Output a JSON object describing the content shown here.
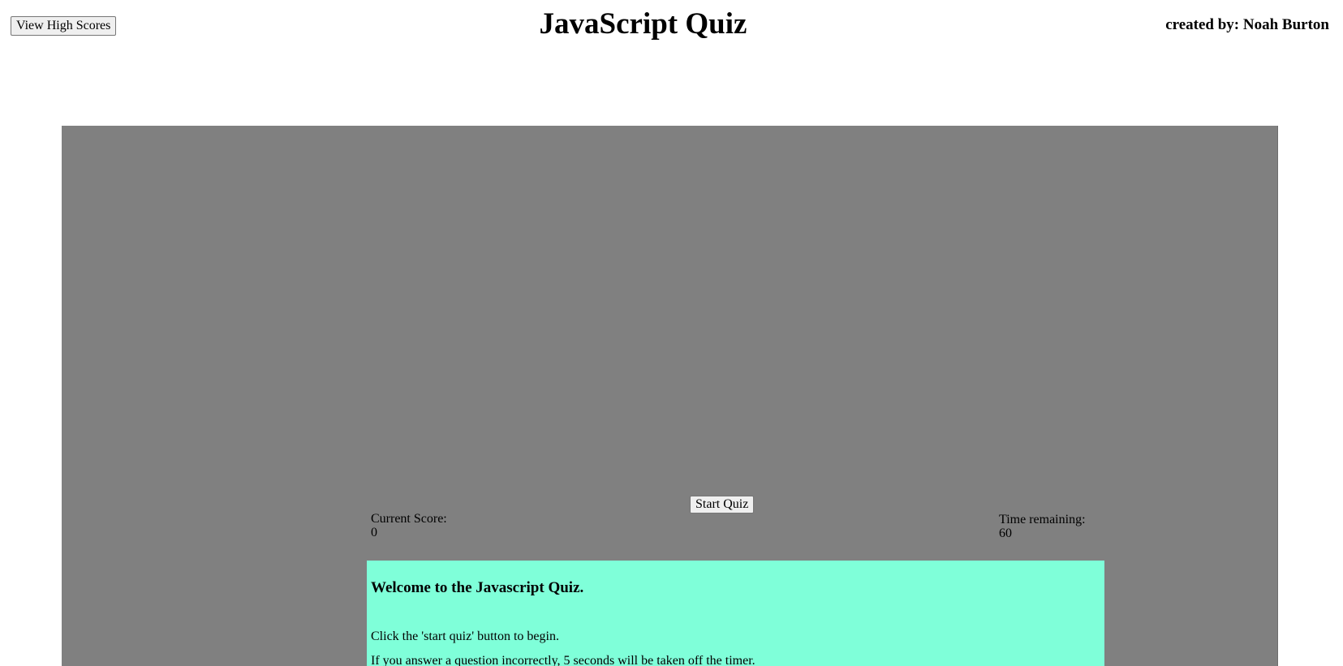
{
  "header": {
    "high_scores_label": "View High Scores",
    "title": "JavaScript Quiz",
    "author": "created by: Noah Burton"
  },
  "quiz": {
    "start_label": "Start Quiz",
    "score_label": "Current Score:",
    "score_value": "0",
    "timer_label": "Time remaining:",
    "timer_value": "60"
  },
  "welcome": {
    "heading": "Welcome to the Javascript Quiz.",
    "line1": "Click the 'start quiz' button to begin.",
    "line2": "If you answer a question incorrectly, 5 seconds will be taken off the timer."
  },
  "colors": {
    "container_bg": "#808080",
    "welcome_bg": "#7fffd9"
  }
}
